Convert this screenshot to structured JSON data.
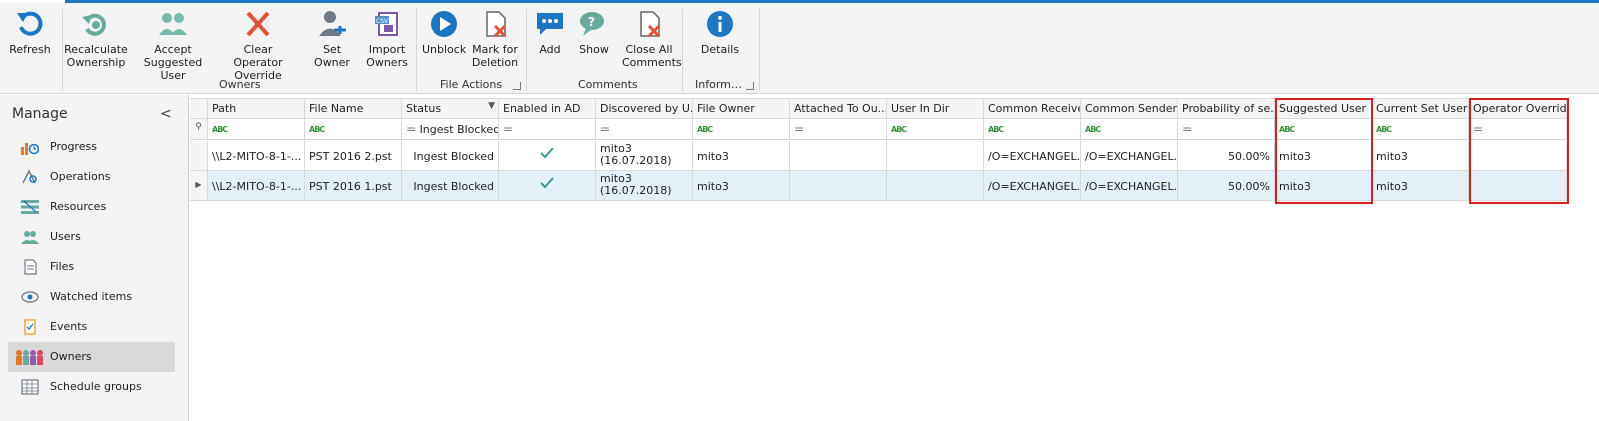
{
  "ribbon": {
    "groups": [
      {
        "label": "",
        "buttons": [
          {
            "label": "Refresh",
            "icon": "refresh-icon"
          }
        ]
      },
      {
        "label": "Owners",
        "buttons": [
          {
            "label": "Recalculate Ownership",
            "icon": "recalculate-icon"
          },
          {
            "label": "Accept Suggested User",
            "icon": "accept-user-icon"
          },
          {
            "label": "Clear Operator Override",
            "icon": "clear-x-icon"
          },
          {
            "label": "Set Owner",
            "icon": "set-owner-icon"
          },
          {
            "label": "Import Owners",
            "icon": "import-csv-icon"
          }
        ]
      },
      {
        "label": "File Actions",
        "buttons": [
          {
            "label": "Unblock",
            "icon": "play-icon"
          },
          {
            "label": "Mark for Deletion",
            "icon": "mark-delete-icon"
          }
        ]
      },
      {
        "label": "Comments",
        "buttons": [
          {
            "label": "Add",
            "icon": "add-comment-icon"
          },
          {
            "label": "Show",
            "icon": "show-comment-icon"
          },
          {
            "label": "Close All Comments",
            "icon": "close-comments-icon"
          }
        ]
      },
      {
        "label": "Inform…",
        "buttons": [
          {
            "label": "Details",
            "icon": "info-icon"
          }
        ]
      }
    ]
  },
  "sidebar": {
    "title": "Manage",
    "collapse_glyph": "<",
    "items": [
      {
        "label": "Progress",
        "icon": "progress-icon"
      },
      {
        "label": "Operations",
        "icon": "operations-icon"
      },
      {
        "label": "Resources",
        "icon": "resources-icon"
      },
      {
        "label": "Users",
        "icon": "users-icon"
      },
      {
        "label": "Files",
        "icon": "files-icon"
      },
      {
        "label": "Watched items",
        "icon": "eye-icon"
      },
      {
        "label": "Events",
        "icon": "events-icon"
      },
      {
        "label": "Owners",
        "icon": "owners-icon",
        "active": true
      },
      {
        "label": "Schedule groups",
        "icon": "schedule-grid-icon"
      }
    ]
  },
  "grid": {
    "columns": [
      "Path",
      "File Name",
      "Status",
      "Enabled in AD",
      "Discovered by U...",
      "File Owner",
      "Attached To Ou...",
      "User In Dir",
      "Common Receiver",
      "Common Sender",
      "Probability of se...",
      "Suggested User",
      "Current Set User",
      "Operator Override"
    ],
    "filter": {
      "abc": "ABC",
      "status_value": "Ingest Blocked"
    },
    "rows": [
      {
        "path": "\\\\L2-MITO-8-1-...",
        "file_name": "PST 2016 2.pst",
        "status": "Ingest Blocked",
        "enabled": true,
        "discovered_line1": "mito3",
        "discovered_line2": "(16.07.2018)",
        "file_owner": "mito3",
        "attached": "",
        "user_in_dir": "",
        "common_receiver": "/O=EXCHANGEL...",
        "common_sender": "/O=EXCHANGEL...",
        "probability": "50.00%",
        "suggested_user": "mito3",
        "current_set_user": "mito3",
        "operator_override": ""
      },
      {
        "path": "\\\\L2-MITO-8-1-...",
        "file_name": "PST 2016 1.pst",
        "status": "Ingest Blocked",
        "enabled": true,
        "discovered_line1": "mito3",
        "discovered_line2": "(16.07.2018)",
        "file_owner": "mito3",
        "attached": "",
        "user_in_dir": "",
        "common_receiver": "/O=EXCHANGEL...",
        "common_sender": "/O=EXCHANGEL...",
        "probability": "50.00%",
        "suggested_user": "mito3",
        "current_set_user": "mito3",
        "operator_override": ""
      }
    ]
  },
  "colors": {
    "accent": "#1d76c2",
    "highlight": "#d21f1f",
    "selected_row": "#e4f0f8",
    "check": "#3a9c8c"
  }
}
